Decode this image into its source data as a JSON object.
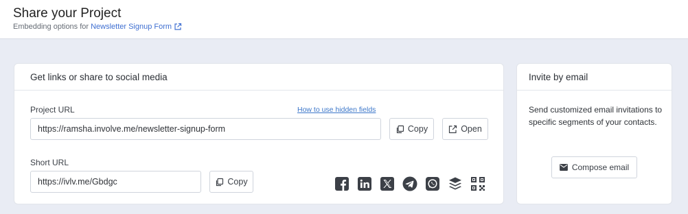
{
  "header": {
    "title": "Share your Project",
    "subtitle_prefix": "Embedding options for",
    "project_link": "Newsletter Signup Form"
  },
  "share_card": {
    "heading": "Get links or share to social media",
    "project_url_label": "Project URL",
    "hidden_fields_link": "How to use hidden fields",
    "project_url_value": "https://ramsha.involve.me/newsletter-signup-form",
    "copy_label": "Copy",
    "open_label": "Open",
    "short_url_label": "Short URL",
    "short_url_value": "https://ivlv.me/Gbdgc",
    "short_copy_label": "Copy",
    "social_icons": [
      "facebook-icon",
      "linkedin-icon",
      "x-icon",
      "telegram-icon",
      "whatsapp-icon",
      "buffer-icon",
      "qr-code-icon"
    ]
  },
  "invite_card": {
    "heading": "Invite by email",
    "description": "Send customized email invitations to specific segments of your contacts.",
    "compose_label": "Compose email"
  },
  "colors": {
    "background": "#e9ecf4",
    "link": "#3f6fd1",
    "icon": "#3c4047"
  }
}
